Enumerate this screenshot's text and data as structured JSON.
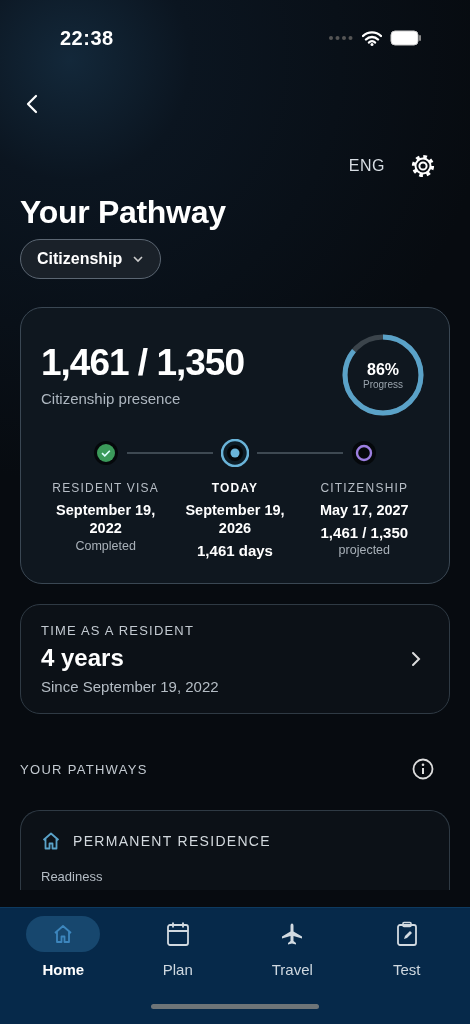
{
  "status_bar": {
    "time": "22:38"
  },
  "header": {
    "language": "ENG",
    "title": "Your Pathway",
    "pathway_select": "Citizenship"
  },
  "presence_card": {
    "count": "1,461 / 1,350",
    "caption": "Citizenship presence",
    "progress": {
      "level": 0.86,
      "percent": "86%",
      "label": "Progress"
    },
    "steps": [
      {
        "kind": "done",
        "label": "RESIDENT VISA",
        "date": "September 19, 2022",
        "lines": [
          {
            "kind": "note",
            "text": "Completed"
          }
        ]
      },
      {
        "kind": "current",
        "label": "TODAY",
        "date": "September 19, 2026",
        "lines": [
          {
            "kind": "value",
            "text": "1,461 days"
          }
        ]
      },
      {
        "kind": "future",
        "label": "CITIZENSHIP",
        "date": "May 17, 2027",
        "lines": [
          {
            "kind": "value",
            "text": "1,461 / 1,350"
          },
          {
            "kind": "note",
            "text": "projected"
          }
        ]
      }
    ]
  },
  "resident_card": {
    "label": "TIME AS A RESIDENT",
    "value": "4 years",
    "since": "Since September 19, 2022"
  },
  "pathways_section": {
    "heading": "YOUR PATHWAYS",
    "cards": [
      {
        "title": "PERMANENT RESIDENCE",
        "subtitle": "Readiness"
      }
    ]
  },
  "tab_bar": [
    {
      "label": "Home",
      "selected": true
    },
    {
      "label": "Plan",
      "selected": false
    },
    {
      "label": "Travel",
      "selected": false
    },
    {
      "label": "Test",
      "selected": false
    }
  ]
}
